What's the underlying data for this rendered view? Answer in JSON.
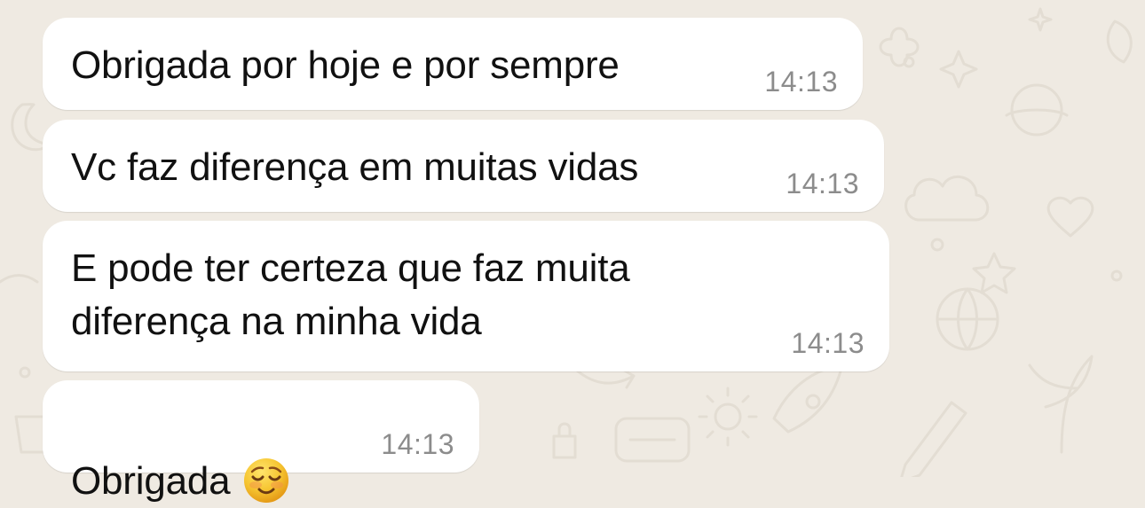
{
  "chat": {
    "messages": [
      {
        "text": "Obrigada por hoje e por sempre",
        "time": "14:13"
      },
      {
        "text": "Vc faz diferença em muitas vidas",
        "time": "14:13"
      },
      {
        "text": "E pode ter certeza que faz muita\ndiferença na minha vida",
        "time": "14:13"
      },
      {
        "text": "Obrigada",
        "emoji": "smiling-face-icon",
        "time": "14:13"
      }
    ]
  },
  "theme": {
    "background": "#efeae2",
    "bubble": "#ffffff",
    "text": "#111111",
    "time": "#8c8c8c"
  }
}
